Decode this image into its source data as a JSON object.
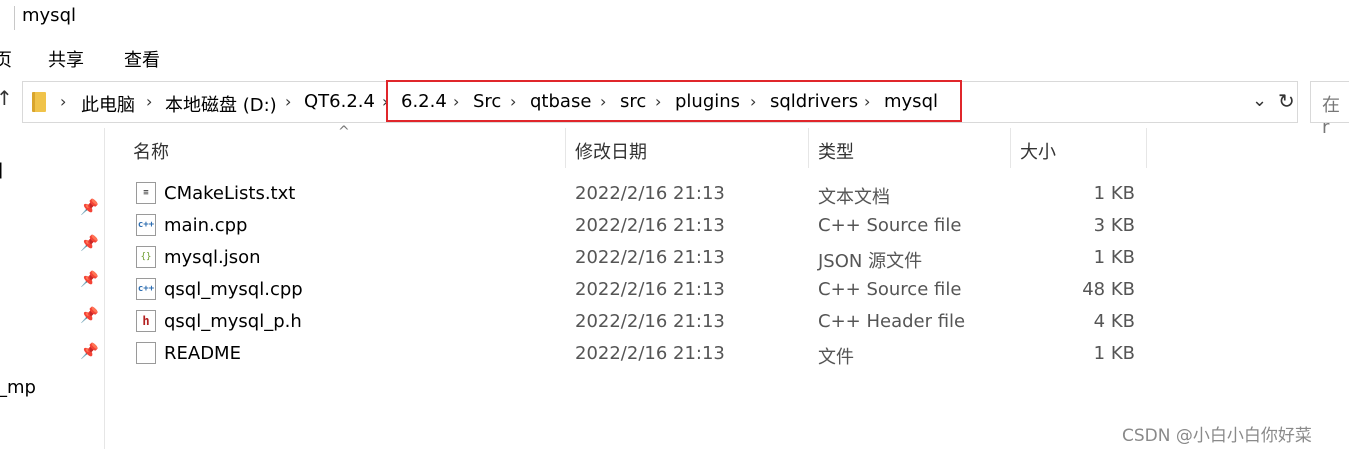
{
  "window": {
    "title": "mysql"
  },
  "ribbon": {
    "tabs": [
      "页",
      "共享",
      "查看"
    ]
  },
  "address": {
    "up_icon": "up-arrow-icon",
    "crumbs": [
      "此电脑",
      "本地磁盘 (D:)",
      "QT6.2.4",
      "6.2.4",
      "Src",
      "qtbase",
      "src",
      "plugins",
      "sqldrivers",
      "mysql"
    ],
    "search_placeholder": "在 r"
  },
  "nav": {
    "fragments": [
      "]",
      "_mp"
    ]
  },
  "columns": {
    "name": "名称",
    "modified": "修改日期",
    "type": "类型",
    "size": "大小"
  },
  "files": [
    {
      "name": "CMakeLists.txt",
      "modified": "2022/2/16 21:13",
      "type": "文本文档",
      "size": "1 KB",
      "icon": "text-file-icon"
    },
    {
      "name": "main.cpp",
      "modified": "2022/2/16 21:13",
      "type": "C++ Source file",
      "size": "3 KB",
      "icon": "cpp-file-icon"
    },
    {
      "name": "mysql.json",
      "modified": "2022/2/16 21:13",
      "type": "JSON 源文件",
      "size": "1 KB",
      "icon": "json-file-icon"
    },
    {
      "name": "qsql_mysql.cpp",
      "modified": "2022/2/16 21:13",
      "type": "C++ Source file",
      "size": "48 KB",
      "icon": "cpp-file-icon"
    },
    {
      "name": "qsql_mysql_p.h",
      "modified": "2022/2/16 21:13",
      "type": "C++ Header file",
      "size": "4 KB",
      "icon": "header-file-icon"
    },
    {
      "name": "README",
      "modified": "2022/2/16 21:13",
      "type": "文件",
      "size": "1 KB",
      "icon": "blank-file-icon"
    }
  ],
  "watermark": "CSDN @小白小白你好菜",
  "colors": {
    "highlight": "#e0262b",
    "cpp_icon": "#2b6cb0",
    "header_icon": "#b32020"
  }
}
